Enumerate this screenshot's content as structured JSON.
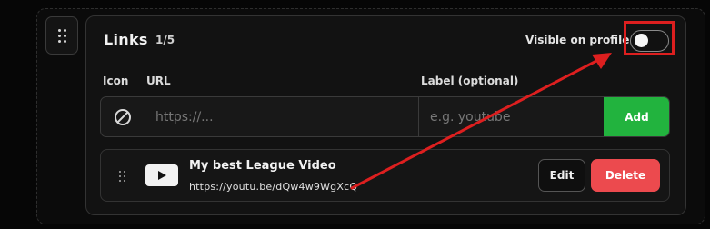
{
  "links_section": {
    "title": "Links",
    "count": "1/5",
    "visibility_label": "Visible on profile",
    "visible_on_profile": false
  },
  "form": {
    "col_icon": "Icon",
    "col_url": "URL",
    "col_label": "Label (optional)",
    "url_placeholder": "https://...",
    "label_placeholder": "e.g. youtube",
    "add_label": "Add",
    "icon": "no-icon"
  },
  "link_items": [
    {
      "title": "My best League Video",
      "url": "https://youtu.be/dQw4w9WgXcQ",
      "icon": "youtube-icon",
      "edit_label": "Edit",
      "delete_label": "Delete"
    }
  ],
  "colors": {
    "add_button": "#22b33e",
    "delete_button": "#ec4a4e",
    "annotation": "#dd1f1f"
  }
}
